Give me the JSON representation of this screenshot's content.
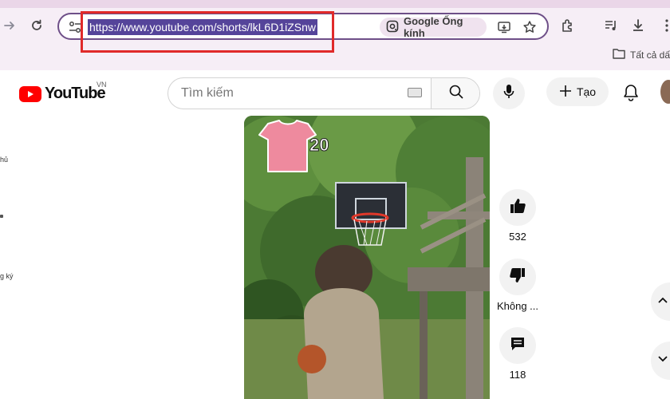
{
  "browser": {
    "url": "https://www.youtube.com/shorts/lkL6D1iZSnw",
    "lens_label": "Google Ống kính",
    "bookmarks_folder": "Tất cả dấ"
  },
  "youtube": {
    "logo_text": "YouTube",
    "region": "VN",
    "search_placeholder": "Tìm kiếm",
    "create_label": "Tạo"
  },
  "sidebar_fragments": [
    "hủ",
    "g ký"
  ],
  "short": {
    "overlay_number": "20",
    "likes": "532",
    "dislike_label": "Không ...",
    "comments": "118"
  },
  "colors": {
    "highlight_box": "#e02a2a",
    "brand_red": "#ff0000",
    "url_selection": "#55449a"
  }
}
